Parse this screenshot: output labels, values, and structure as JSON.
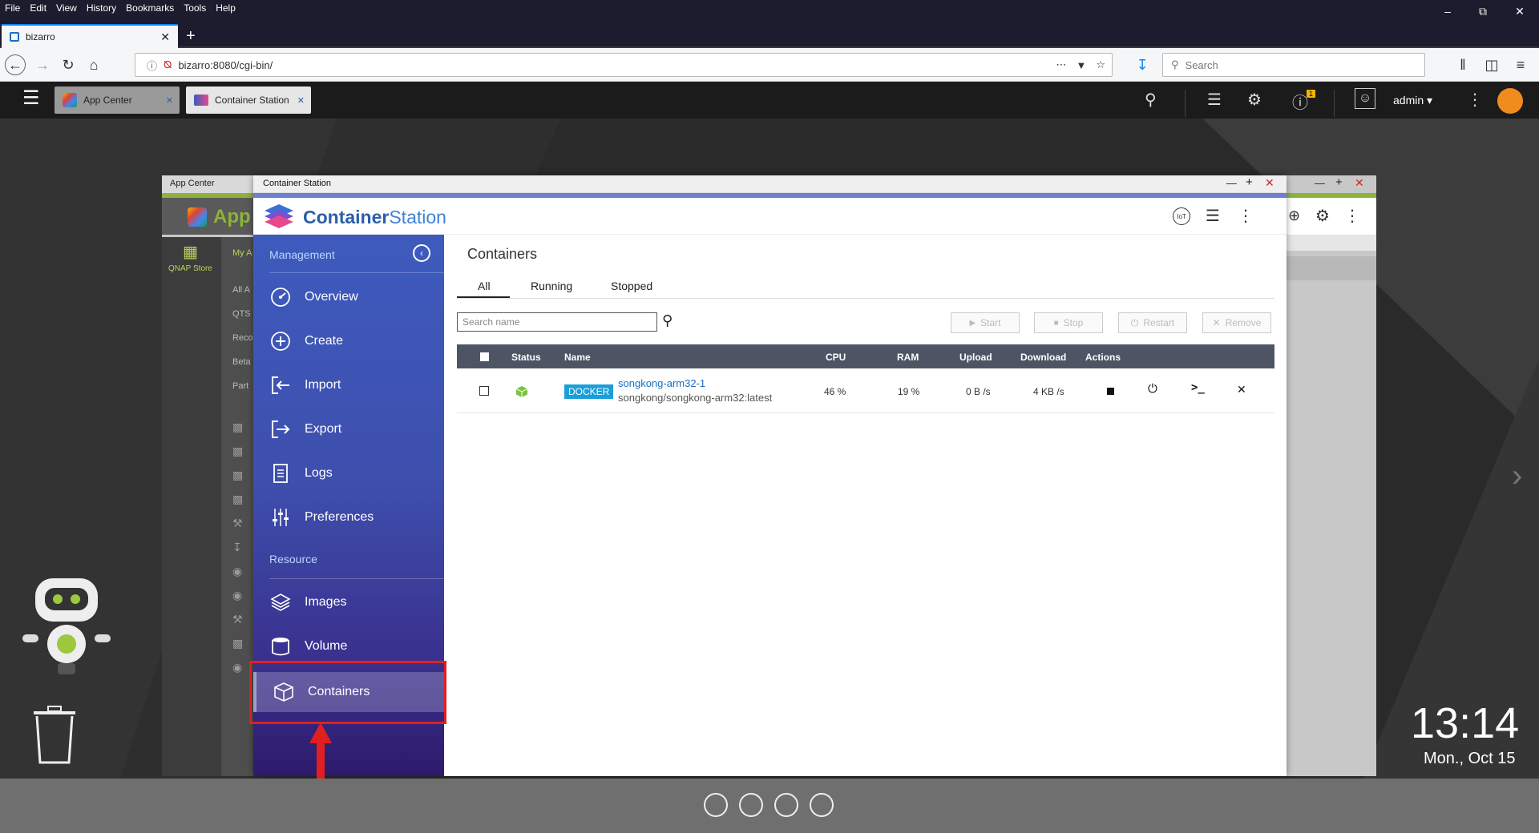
{
  "browser": {
    "menu": [
      "File",
      "Edit",
      "View",
      "History",
      "Bookmarks",
      "Tools",
      "Help"
    ],
    "tab_title": "bizarro",
    "url": "bizarro:8080/cgi-bin/",
    "search_placeholder": "Search"
  },
  "qts": {
    "tabs": [
      "App Center",
      "Container Station"
    ],
    "user": "admin",
    "notification_count": "1",
    "clock_time": "13:14",
    "clock_date": "Mon., Oct 15"
  },
  "appcenter": {
    "title": "App Center",
    "brand": "App",
    "store_label": "QNAP Store",
    "my_apps": "My A",
    "categories": [
      "All A",
      "QTS",
      "Reco",
      "Beta",
      "Part"
    ]
  },
  "cs": {
    "window_title": "Container Station",
    "brand_bold": "Container",
    "brand_light": "Station",
    "management_label": "Management",
    "resource_label": "Resource",
    "nav": [
      {
        "label": "Overview",
        "icon": "overview-icon"
      },
      {
        "label": "Create",
        "icon": "create-icon"
      },
      {
        "label": "Import",
        "icon": "import-icon"
      },
      {
        "label": "Export",
        "icon": "export-icon"
      },
      {
        "label": "Logs",
        "icon": "logs-icon"
      },
      {
        "label": "Preferences",
        "icon": "preferences-icon"
      }
    ],
    "resource_nav": [
      {
        "label": "Images",
        "icon": "images-icon"
      },
      {
        "label": "Volume",
        "icon": "volume-icon"
      },
      {
        "label": "Containers",
        "icon": "containers-icon"
      }
    ],
    "page_title": "Containers",
    "filter_tabs": [
      "All",
      "Running",
      "Stopped"
    ],
    "search_placeholder": "Search name",
    "action_buttons": [
      "Start",
      "Stop",
      "Restart",
      "Remove"
    ],
    "columns": [
      "Status",
      "Name",
      "CPU",
      "RAM",
      "Upload",
      "Download",
      "Actions"
    ],
    "rows": [
      {
        "badge": "DOCKER",
        "name": "songkong-arm32-1",
        "image": "songkong/songkong-arm32:latest",
        "cpu": "46 %",
        "ram": "19 %",
        "upload": "0 B /s",
        "download": "4 KB /s"
      }
    ]
  },
  "colors": {
    "sidebar_top": "#3d5bbd",
    "sidebar_bottom": "#2d1a6b",
    "highlight": "#e02020",
    "docker_badge": "#1a9fd8",
    "link": "#1a6fc2"
  }
}
